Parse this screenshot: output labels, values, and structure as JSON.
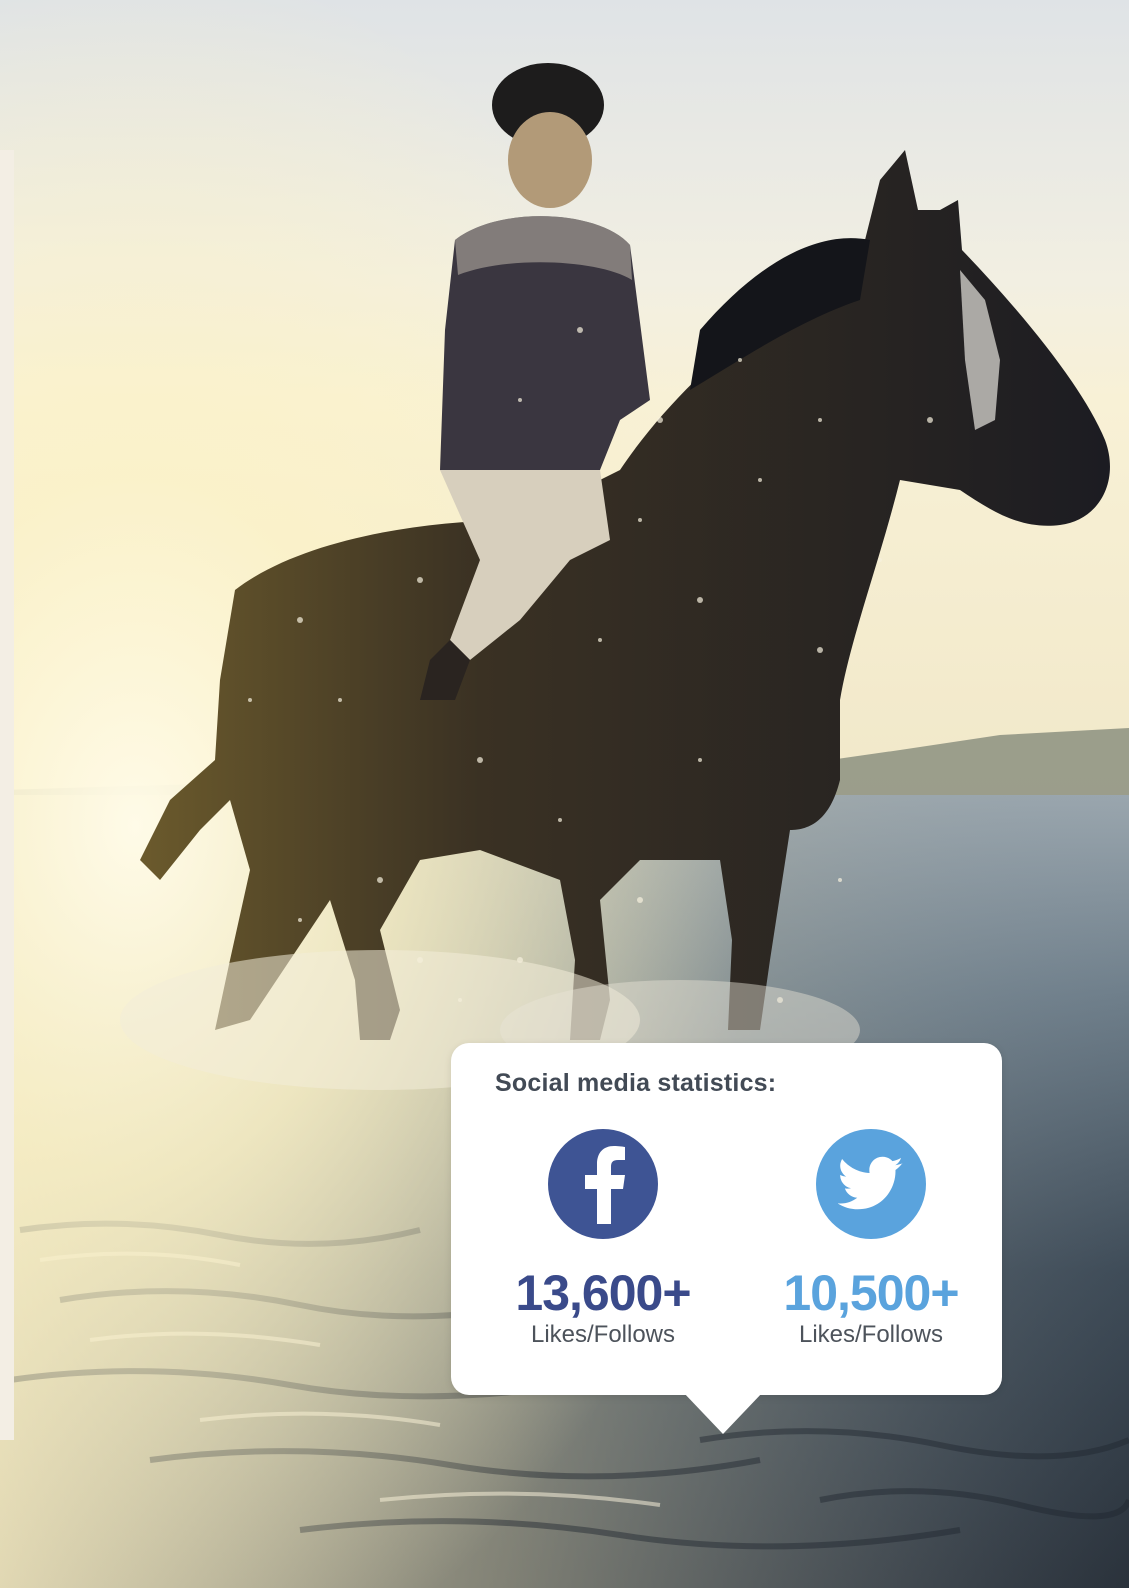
{
  "card": {
    "title": "Social media statistics:",
    "stats": [
      {
        "network": "facebook",
        "icon": "facebook-icon",
        "value": "13,600+",
        "label": "Likes/Follows",
        "color": "#3e5494"
      },
      {
        "network": "twitter",
        "icon": "twitter-icon",
        "value": "10,500+",
        "label": "Likes/Follows",
        "color": "#5aa3dd"
      }
    ]
  },
  "photo": {
    "subject": "horse-rider-photo"
  }
}
